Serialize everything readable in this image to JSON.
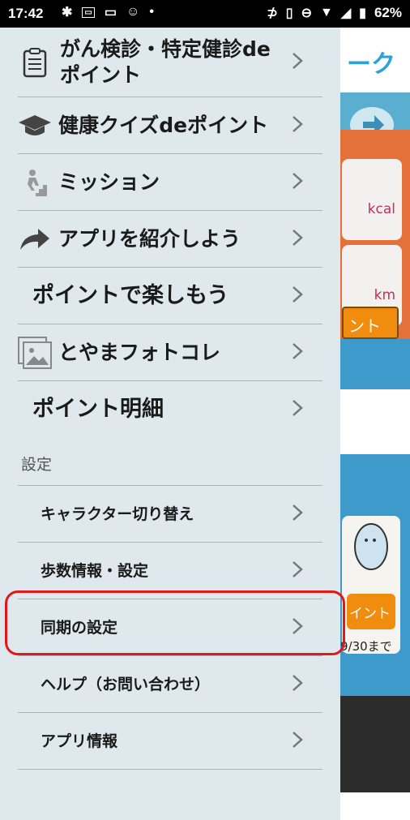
{
  "status_bar": {
    "time": "17:42",
    "battery": "62%",
    "left_icons": [
      "slack-icon",
      "notification-icon",
      "cast-icon",
      "app-icon",
      "dot-icon"
    ],
    "right_icons": [
      "nfc-icon",
      "vibrate-icon",
      "dnd-icon",
      "wifi-icon",
      "signal-icon",
      "battery-icon"
    ]
  },
  "drawer": {
    "items": [
      {
        "label": "がん検診・特定健診de",
        "label_line2": "ポイント",
        "icon": "clipboard-icon"
      },
      {
        "label": "健康クイズdeポイント",
        "icon": "graduation-cap-icon"
      },
      {
        "label": "ミッション",
        "icon": "stairs-runner-icon"
      },
      {
        "label": "アプリを紹介しよう",
        "icon": "share-arrow-icon"
      },
      {
        "label": "ポイントで楽しもう",
        "icon": ""
      },
      {
        "label": "とやまフォトコレ",
        "icon": "photo-gallery-icon"
      },
      {
        "label": "ポイント明細",
        "icon": ""
      }
    ],
    "settings_header": "設定",
    "settings_items": [
      {
        "label": "キャラクター切り替え"
      },
      {
        "label": "歩数情報・設定"
      },
      {
        "label": "同期の設定"
      },
      {
        "label": "ヘルプ（お問い合わせ）"
      },
      {
        "label": "アプリ情報"
      }
    ],
    "highlighted_item": "同期の設定"
  },
  "background": {
    "header_text": "ーク",
    "card_units": [
      "kcal",
      "km"
    ],
    "button_text": "ント",
    "point_button": "イント",
    "date_text": "9/30まで"
  },
  "colors": {
    "drawer_bg": "#dfe8ec",
    "highlight": "#e01818",
    "accent": "#2aa3d8"
  }
}
